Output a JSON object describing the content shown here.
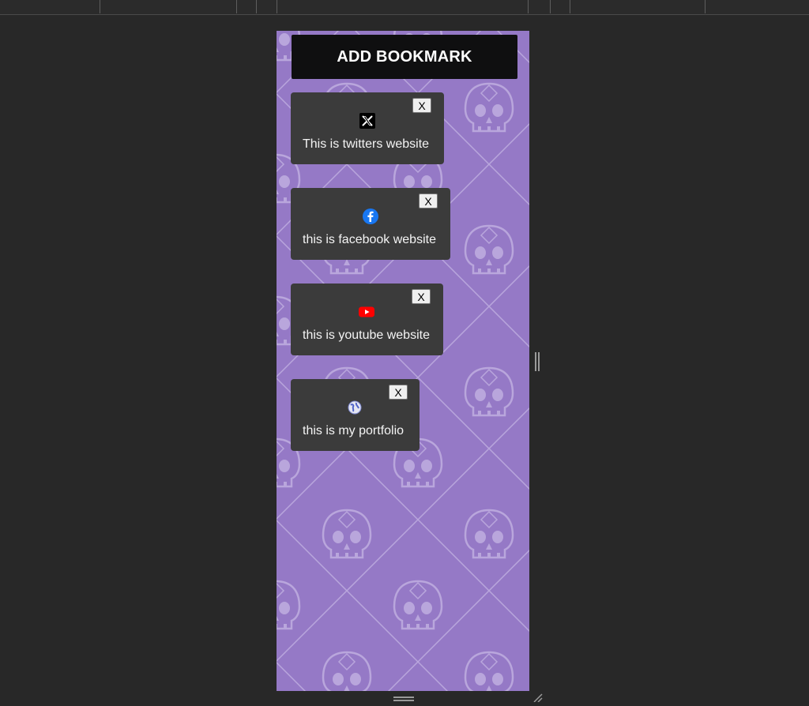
{
  "add_button": {
    "label": "ADD BOOKMARK"
  },
  "bookmarks": [
    {
      "title": "This is twitters website",
      "icon": "x-logo-icon",
      "close_label": "X"
    },
    {
      "title": "this is facebook website",
      "icon": "facebook-logo-icon",
      "close_label": "X"
    },
    {
      "title": "this is youtube website",
      "icon": "youtube-logo-icon",
      "close_label": "X"
    },
    {
      "title": "this is my portfolio",
      "icon": "globe-icon",
      "close_label": "X"
    }
  ],
  "colors": {
    "page_background": "#282828",
    "viewport_background": "#9579c6",
    "pattern": "#b9a6dc",
    "card": "#3b3b3b",
    "button": "#0f0f10"
  }
}
